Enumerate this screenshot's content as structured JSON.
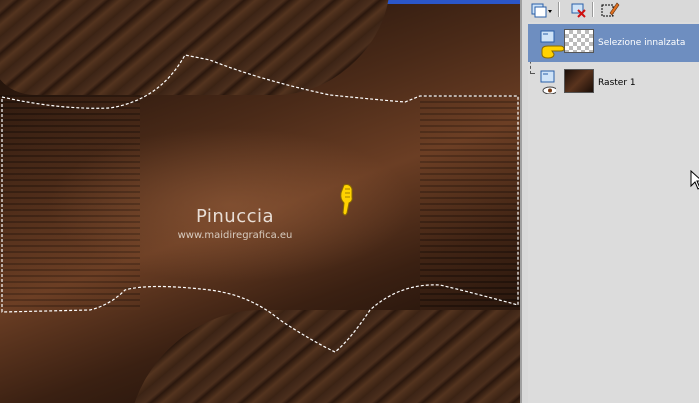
{
  "canvas": {
    "watermark_title": "Pinuccia",
    "watermark_url": "www.maidiregrafica.eu"
  },
  "layers_panel": {
    "toolbar": [
      {
        "icon": "new-raster-layer-icon"
      },
      {
        "icon": "delete-layer-icon"
      },
      {
        "icon": "edit-selection-icon"
      }
    ],
    "layers": [
      {
        "name": "Selezione innalzata",
        "selected": true,
        "thumbnail": "checker-transparent"
      },
      {
        "name": "Raster 1",
        "selected": false,
        "thumbnail": "brown-texture"
      }
    ]
  },
  "colors": {
    "selected_row": "#6e8ec0",
    "panel_bg": "#d9d9d9",
    "accent_blue": "#2b56c8"
  }
}
